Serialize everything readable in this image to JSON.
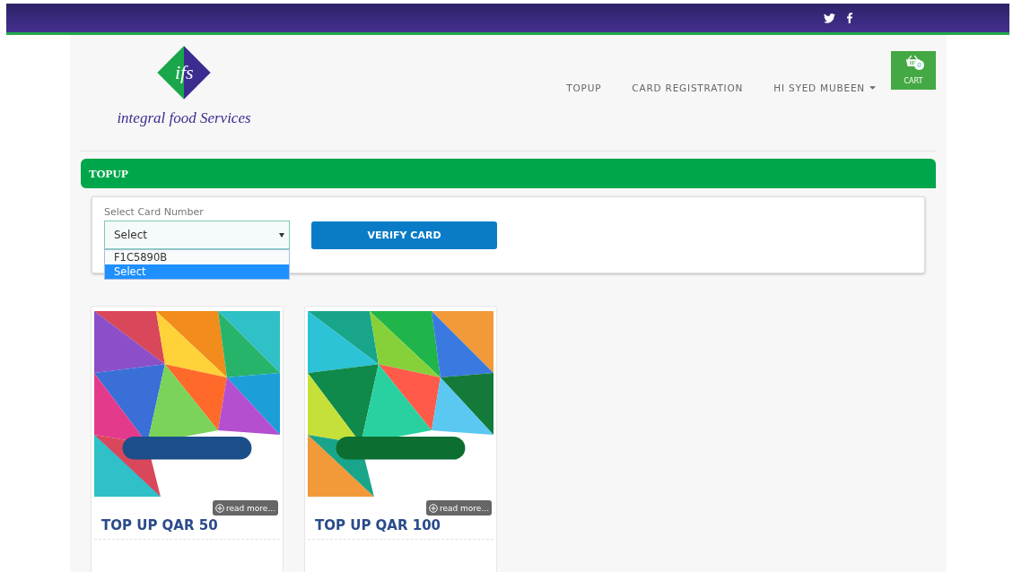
{
  "logo": {
    "mark": "ifs",
    "name": "integral food Services"
  },
  "nav": [
    {
      "label": "TOPUP",
      "kind": "link"
    },
    {
      "label": "CARD REGISTRATION",
      "kind": "link"
    },
    {
      "label": "HI SYED MUBEEN",
      "kind": "dropdown"
    }
  ],
  "cart": {
    "label": "CART",
    "count": "0"
  },
  "section_title": "TOPUP",
  "form": {
    "label": "Select Card Number",
    "select": {
      "value": "Select",
      "expanded": true,
      "options": [
        {
          "label": "F1C5890B",
          "selected": false
        },
        {
          "label": "Select",
          "selected": true
        }
      ]
    },
    "button": "VERIFY CARD"
  },
  "products": [
    {
      "kind": "picture",
      "read_more": "read more...",
      "title": "TOP UP QAR 50"
    },
    {
      "kind": "picture",
      "read_more": "read more...",
      "title": "TOP UP QAR 100"
    }
  ]
}
